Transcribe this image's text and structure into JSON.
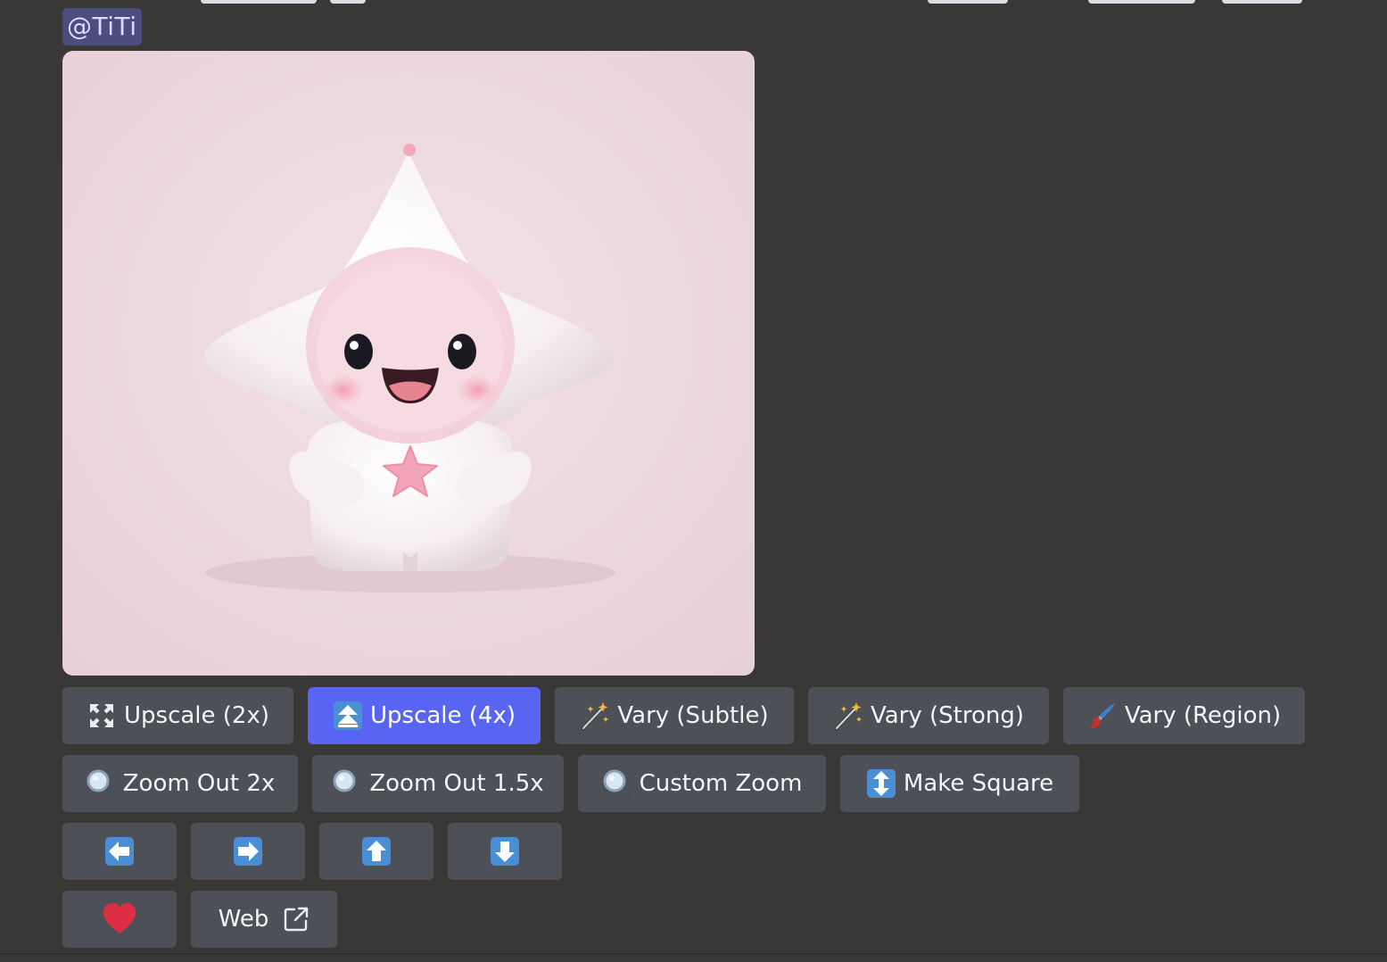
{
  "message": {
    "mention": "@TiTi"
  },
  "buttons": {
    "row1": [
      {
        "label": "Upscale (2x)",
        "icon": "expand-arrows-icon"
      },
      {
        "label": "Upscale (4x)",
        "icon": "double-up-arrow-icon",
        "active": true
      },
      {
        "label": "Vary (Subtle)",
        "icon": "magic-wand-icon"
      },
      {
        "label": "Vary (Strong)",
        "icon": "magic-wand-icon"
      },
      {
        "label": "Vary (Region)",
        "icon": "paintbrush-icon"
      }
    ],
    "row2": [
      {
        "label": "Zoom Out 2x",
        "icon": "magnifier-icon"
      },
      {
        "label": "Zoom Out 1.5x",
        "icon": "magnifier-icon"
      },
      {
        "label": "Custom Zoom",
        "icon": "magnifier-icon"
      },
      {
        "label": "Make Square",
        "icon": "up-down-arrow-icon"
      }
    ],
    "row3": [
      {
        "icon": "arrow-left-icon"
      },
      {
        "icon": "arrow-right-icon"
      },
      {
        "icon": "arrow-up-icon"
      },
      {
        "icon": "arrow-down-icon"
      }
    ],
    "row4": [
      {
        "icon": "heart-icon"
      },
      {
        "label": "Web",
        "icon": "external-link-icon"
      }
    ]
  },
  "colors": {
    "background": "#393836",
    "button": "#4d5057",
    "button_active": "#5865f2",
    "mention_bg": "#4a4d7e",
    "emoji_blue": "#4a8fd4",
    "heart": "#dd2e44"
  }
}
